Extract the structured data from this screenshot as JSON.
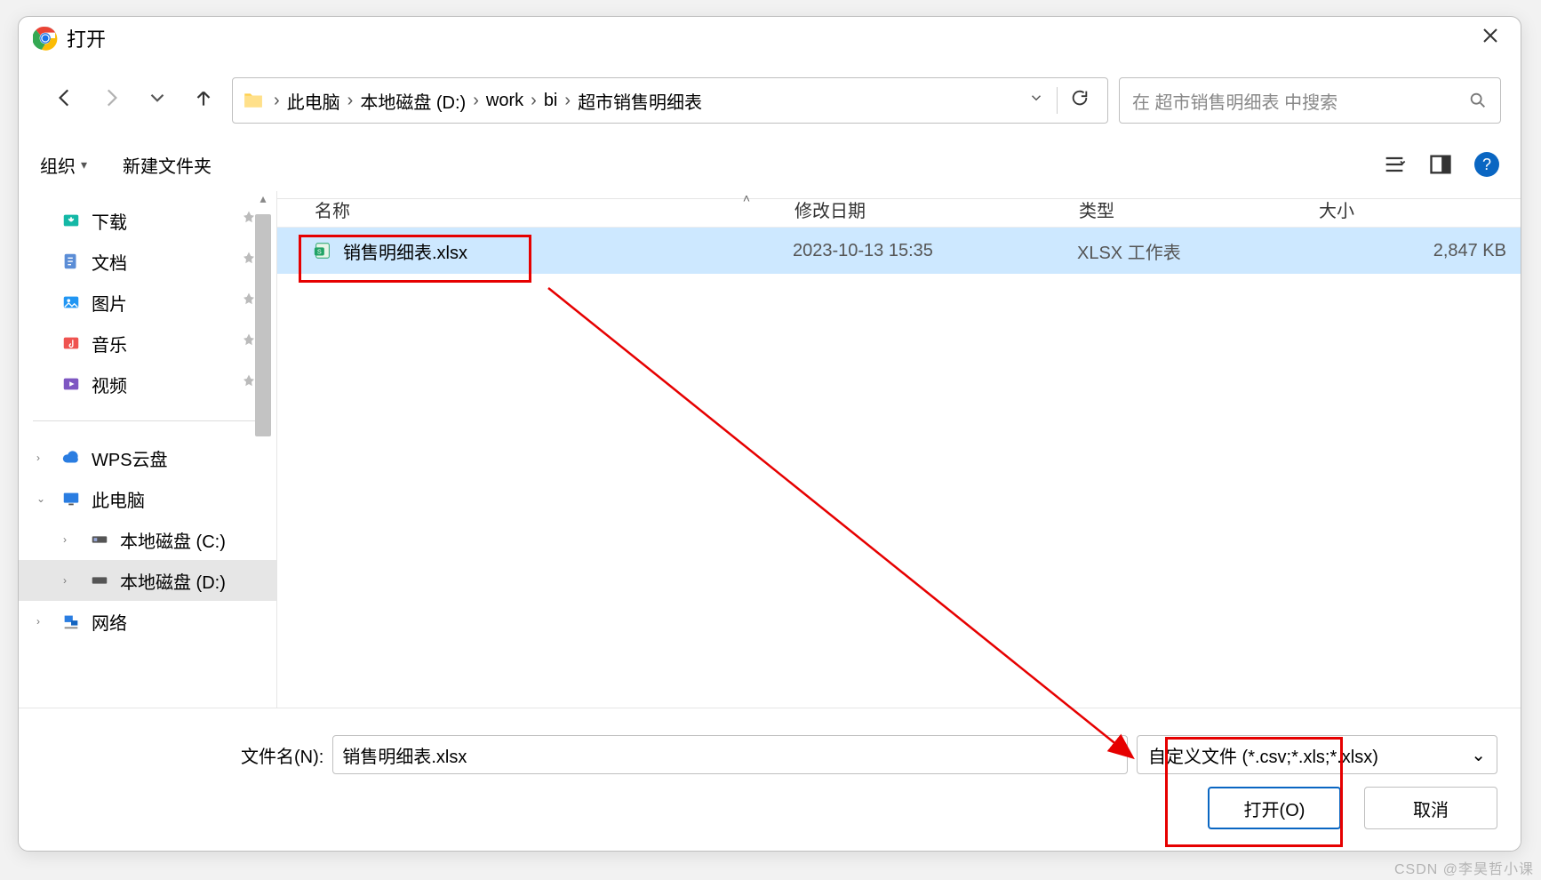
{
  "dialog_title": "打开",
  "breadcrumbs": [
    "此电脑",
    "本地磁盘 (D:)",
    "work",
    "bi",
    "超市销售明细表"
  ],
  "search_placeholder": "在 超市销售明细表 中搜索",
  "toolbar": {
    "organize": "组织",
    "new_folder": "新建文件夹"
  },
  "sidebar_quick": {
    "downloads": "下载",
    "documents": "文档",
    "pictures": "图片",
    "music": "音乐",
    "videos": "视频"
  },
  "sidebar_places": {
    "wps_cloud": "WPS云盘",
    "this_pc": "此电脑",
    "drive_c": "本地磁盘 (C:)",
    "drive_d": "本地磁盘 (D:)",
    "network": "网络"
  },
  "columns": {
    "name": "名称",
    "date": "修改日期",
    "type": "类型",
    "size": "大小"
  },
  "file": {
    "name": "销售明细表.xlsx",
    "date": "2023-10-13 15:35",
    "type": "XLSX 工作表",
    "size": "2,847 KB"
  },
  "footer": {
    "filename_label": "文件名(N):",
    "filename_value": "销售明细表.xlsx",
    "filetype_value": "自定义文件 (*.csv;*.xls;*.xlsx)",
    "open_label": "打开(O)",
    "cancel_label": "取消"
  },
  "watermark": "CSDN @李昊哲小课"
}
